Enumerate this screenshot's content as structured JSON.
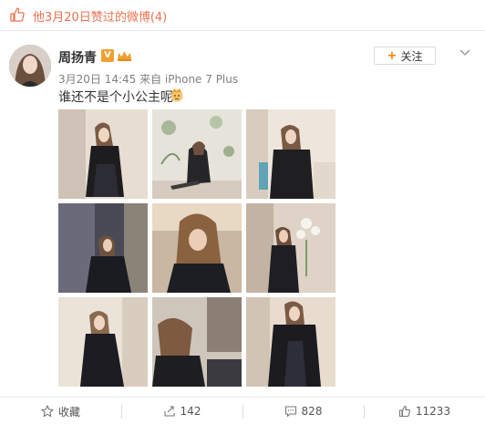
{
  "header": {
    "text": "他3月20日赞过的微博(4)",
    "icon": "thumbs-up-icon"
  },
  "post": {
    "username": "周扬青",
    "verified_badge": "V",
    "crown_badge": "crown-icon",
    "meta": "3月20日 14:45 来自 iPhone 7 Plus",
    "text": "谁还不是个小公主呢",
    "emoji": "princess-emoji-icon",
    "follow_label": "关注",
    "follow_plus": "+"
  },
  "photos": [
    {
      "name": "photo-1",
      "scene": "seated-black-blazer"
    },
    {
      "name": "photo-2",
      "scene": "floral-wallpaper-floor"
    },
    {
      "name": "photo-3",
      "scene": "sofa-phone"
    },
    {
      "name": "photo-4",
      "scene": "mirror-seated"
    },
    {
      "name": "photo-5",
      "scene": "hair-down-closeup"
    },
    {
      "name": "photo-6",
      "scene": "orchid-standing"
    },
    {
      "name": "photo-7",
      "scene": "seated-leaning"
    },
    {
      "name": "photo-8",
      "scene": "head-down"
    },
    {
      "name": "photo-9",
      "scene": "blazer-standing"
    }
  ],
  "actions": {
    "favorite_label": "收藏",
    "repost_count": "142",
    "comment_count": "828",
    "like_count": "11233"
  },
  "colors": {
    "accent": "#eb7350",
    "follow_plus": "#ff8200",
    "badge": "#f0a030"
  }
}
